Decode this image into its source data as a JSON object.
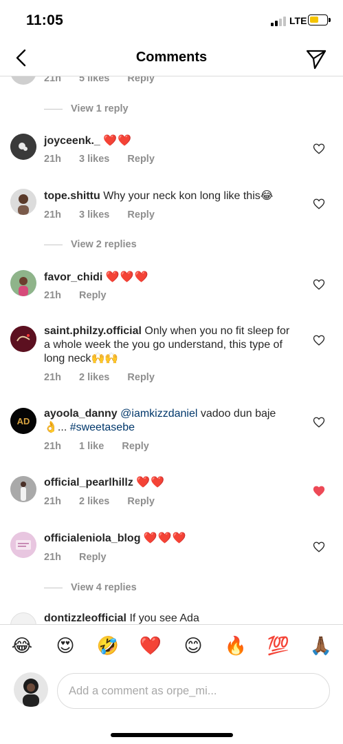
{
  "status": {
    "time": "11:05",
    "network": "LTE",
    "battery_color": "#f5c400"
  },
  "header": {
    "title": "Comments",
    "back_icon": "chevron-left-icon",
    "share_icon": "direct-send-icon"
  },
  "partial_top": {
    "time": "21h",
    "likes": "5 likes",
    "reply": "Reply",
    "view_replies": "View 1 reply"
  },
  "comments": [
    {
      "username": "joyceenk._",
      "text": "",
      "hearts": "❤️❤️",
      "time": "21h",
      "likes": "3 likes",
      "reply": "Reply",
      "liked": false
    },
    {
      "username": "tope.shittu",
      "text": " Why your neck kon long like this😂",
      "hearts": "",
      "time": "21h",
      "likes": "3 likes",
      "reply": "Reply",
      "liked": false,
      "view_replies": "View 2 replies"
    },
    {
      "username": "favor_chidi",
      "text": "",
      "hearts": "❤️❤️❤️",
      "time": "21h",
      "likes": "",
      "reply": "Reply",
      "liked": false
    },
    {
      "username": "saint.philzy.official",
      "text": " Only when you no fit sleep for a whole week the you go understand, this type of long neck🙌🙌",
      "hearts": "",
      "time": "21h",
      "likes": "2 likes",
      "reply": "Reply",
      "liked": false
    },
    {
      "username": "ayoola_danny",
      "mention": " @iamkizzdaniel",
      "text": " vadoo dun baje 👌... ",
      "hashtag": "#sweetasebe",
      "time": "21h",
      "likes": "1 like",
      "reply": "Reply",
      "liked": false
    },
    {
      "username": "official_pearlhillz",
      "text": "",
      "hearts": "❤️❤️",
      "time": "21h",
      "likes": "2 likes",
      "reply": "Reply",
      "liked": true
    },
    {
      "username": "officialeniola_blog",
      "text": "",
      "hearts": "❤️❤️❤️",
      "time": "21h",
      "likes": "",
      "reply": "Reply",
      "liked": false,
      "view_replies": "View 4 replies"
    },
    {
      "username": "dontizzleofficial",
      "text": " If you see Ada",
      "hearts": ""
    }
  ],
  "emoji_bar": [
    "😂",
    "😍",
    "🤣",
    "❤️",
    "😊",
    "🔥",
    "💯",
    "🙏🏾"
  ],
  "composer": {
    "placeholder": "Add a comment as orpe_mi..."
  },
  "colors": {
    "heart_red": "#ed4956",
    "secondary_text": "#8e8e8e",
    "mention_blue": "#00376b"
  }
}
